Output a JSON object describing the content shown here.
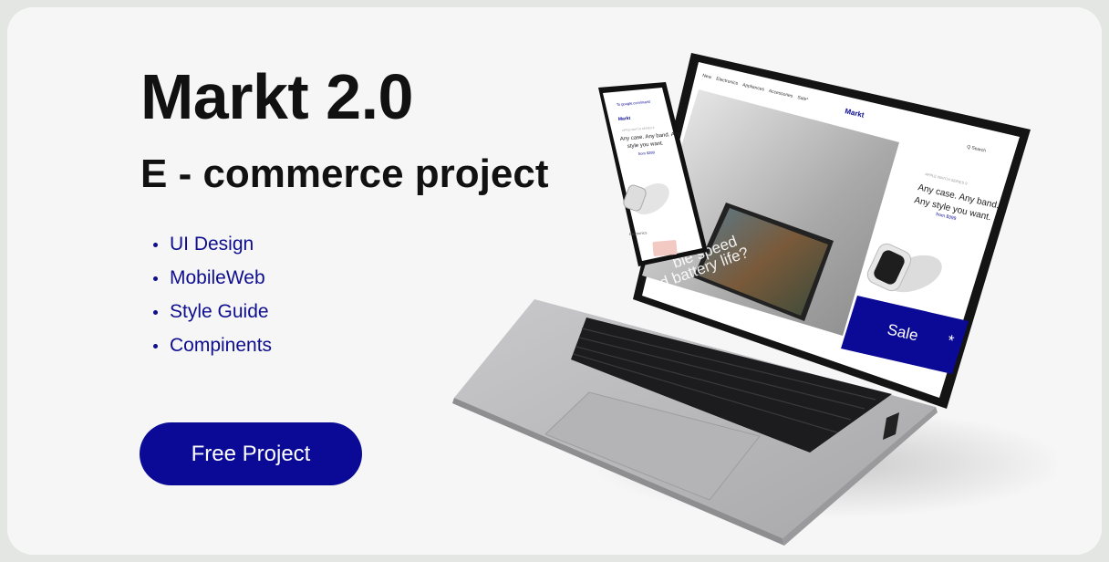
{
  "hero": {
    "title": "Markt 2.0",
    "subtitle": "E - commerce project",
    "features": [
      "UI Design",
      "MobileWeb",
      "Style Guide",
      "Compinents"
    ],
    "cta_label": "Free Project"
  },
  "laptop_screen": {
    "nav_items": [
      "New",
      "Electronics",
      "Appliances",
      "Accessories",
      "Sale*"
    ],
    "logo": "Markt",
    "search_label": "Q Search",
    "hero_text_line1": "ble speed",
    "hero_text_line2": "d battery life?",
    "product_eyebrow": "APPLE WATCH SERIES 9",
    "product_headline": [
      "Any case. Any band.",
      "Any style you want."
    ],
    "product_price": "from $399",
    "sale_label": "Sale",
    "sale_asterisk": "*"
  },
  "phone_screen": {
    "url": "To google.com/markt",
    "logo": "Markt",
    "product_eyebrow": "APPLE WATCH SERIES 9",
    "product_headline": [
      "Any case. Any band. Any",
      "style you want."
    ],
    "product_price": "from $399",
    "section_label": "Electronics"
  },
  "colors": {
    "accent": "#0a0a96",
    "feature_text": "#0e0e8f",
    "card_bg": "#f6f6f6",
    "page_bg": "#e3e6e3"
  }
}
